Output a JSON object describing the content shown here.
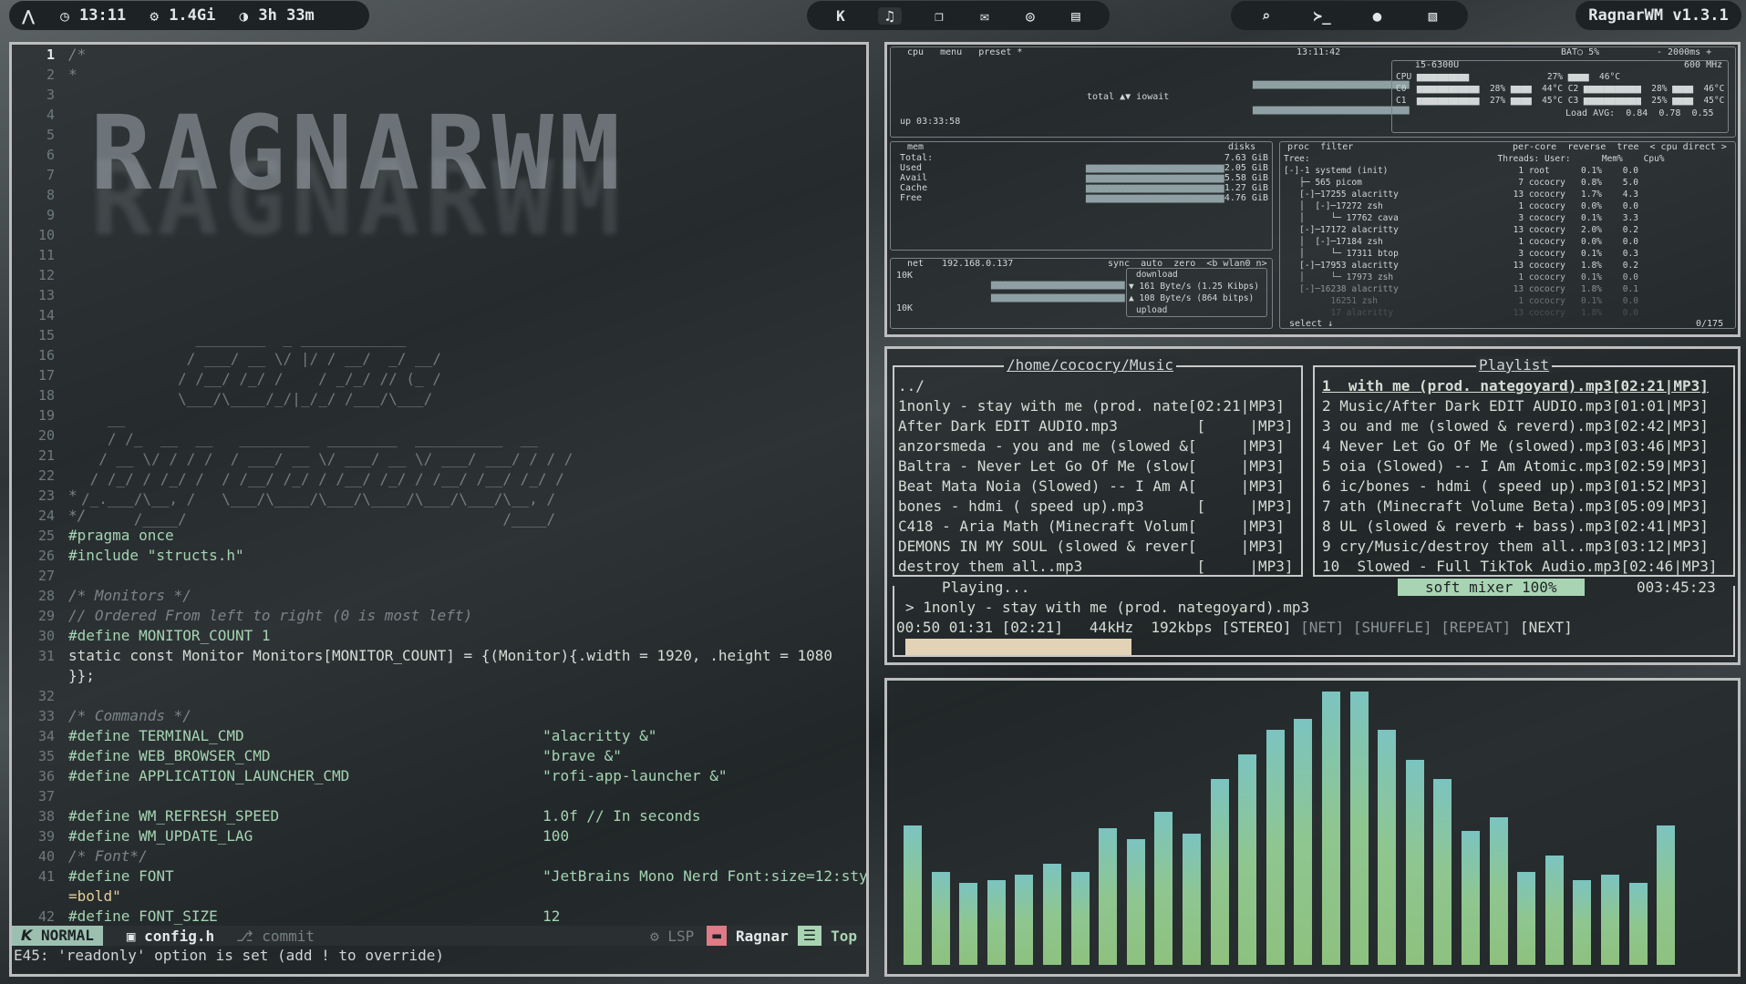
{
  "topbar": {
    "left": [
      {
        "icon": "arch-logo-icon",
        "label": ""
      },
      {
        "icon": "clock-icon",
        "label": "13:11"
      },
      {
        "icon": "memory-icon",
        "label": "1.4Gi"
      },
      {
        "icon": "uptime-icon",
        "label": "3h 33m"
      }
    ],
    "apps": [
      "k-app-icon",
      "music-icon",
      "copy-icon",
      "mail-icon",
      "gamepad-icon",
      "book-icon"
    ],
    "launchers": [
      "search-icon",
      "terminal-icon",
      "record-icon",
      "image-icon"
    ],
    "wm_name": "RagnarWM v1.3.1"
  },
  "editor": {
    "line_numbers": [
      "1",
      "2",
      "3",
      "4",
      "5",
      "6",
      "7",
      "8",
      "9",
      "10",
      "11",
      "12",
      "13",
      "14",
      "15",
      "16",
      "17",
      "18",
      "19",
      "20",
      "21",
      "22",
      "23",
      "24",
      "25",
      "26",
      "27",
      "28",
      "29",
      "30",
      "31",
      "",
      "32",
      "33",
      "34",
      "35",
      "36",
      "37",
      "38",
      "39",
      "40",
      "41",
      "",
      "42"
    ],
    "art_word": "RAGNARWM",
    "art_lines": [
      "",
      "",
      "",
      "",
      "",
      "",
      "",
      "",
      "",
      "",
      "",
      "",
      "             ________  _ ____________",
      "            / ___/ __ \\/ |/ / __/  _/ __/",
      "           / /__/ /_/ /    / _/_/ // (_ /",
      "           \\___/\\____/_/|_/_/ /___/\\___/",
      "   __",
      "   / /_  __  __   ________  ________  __________  __",
      "  / __ \\/ / / /  / ___/ __ \\/ ___/ __ \\/ ___/ ___/ / / /",
      " / /_/ / /_/ /  / /__/ /_/ / /__/ /_/ / /__/ /__/ /_/ /",
      "/_.___/\\__, /   \\___/\\____/\\___/\\____/\\___/\\___/\\__, /",
      "      /____/                                    /____/"
    ],
    "lines": [
      {
        "t": "/*",
        "c": "cm"
      },
      {
        "t": "*",
        "c": "cm"
      },
      {
        "t": "",
        "c": "tx"
      },
      {
        "t": "",
        "c": "tx"
      },
      {
        "t": "",
        "c": "tx"
      },
      {
        "t": "",
        "c": "tx"
      },
      {
        "t": "",
        "c": "tx"
      },
      {
        "t": "",
        "c": "tx"
      },
      {
        "t": "",
        "c": "tx"
      },
      {
        "t": "",
        "c": "tx"
      },
      {
        "t": "",
        "c": "tx"
      },
      {
        "t": "",
        "c": "tx"
      },
      {
        "t": "",
        "c": "tx"
      },
      {
        "t": "",
        "c": "tx"
      },
      {
        "t": "",
        "c": "tx"
      },
      {
        "t": "",
        "c": "tx"
      },
      {
        "t": "",
        "c": "tx"
      },
      {
        "t": "",
        "c": "tx"
      },
      {
        "t": "",
        "c": "tx"
      },
      {
        "t": "",
        "c": "tx"
      },
      {
        "t": "",
        "c": "tx"
      },
      {
        "t": "",
        "c": "tx"
      },
      {
        "t": "*",
        "c": "cm"
      },
      {
        "t": "*/",
        "c": "cm"
      },
      {
        "t": "#pragma once",
        "c": "pp"
      },
      {
        "t": "#include \"structs.h\"",
        "c": "pp"
      },
      {
        "t": "",
        "c": "tx"
      },
      {
        "t": "/* Monitors */",
        "c": "cm"
      },
      {
        "t": "// Ordered From left to right (0 is most left)",
        "c": "cm"
      },
      {
        "t": "#define MONITOR_COUNT 1",
        "c": "pp"
      },
      {
        "t": "static const Monitor Monitors[MONITOR_COUNT] = {(Monitor){.width = 1920, .height = 1080",
        "c": "tx"
      },
      {
        "t": "}};",
        "c": "tx"
      },
      {
        "t": "",
        "c": "tx"
      },
      {
        "t": "/* Commands */",
        "c": "cm"
      },
      {
        "t": "#define TERMINAL_CMD                                  \"alacritty &\"",
        "c": "pp"
      },
      {
        "t": "#define WEB_BROWSER_CMD                               \"brave &\"",
        "c": "pp"
      },
      {
        "t": "#define APPLICATION_LAUNCHER_CMD                      \"rofi-app-launcher &\"",
        "c": "pp"
      },
      {
        "t": "",
        "c": "tx"
      },
      {
        "t": "#define WM_REFRESH_SPEED                              1.0f // In seconds",
        "c": "pp"
      },
      {
        "t": "#define WM_UPDATE_LAG                                 100",
        "c": "pp"
      },
      {
        "t": "/* Font*/",
        "c": "cm"
      },
      {
        "t": "#define FONT                                          \"JetBrains Mono Nerd Font:size=12:style",
        "c": "pp"
      },
      {
        "t": "=bold\"",
        "c": "st"
      },
      {
        "t": "#define FONT_SIZE                                     12",
        "c": "pp"
      }
    ],
    "status": {
      "mode": "NORMAL",
      "file": "config.h",
      "commit": "commit",
      "lsp": "LSP",
      "user": "Ragnar",
      "position": "Top"
    },
    "message": "E45: 'readonly' option is set (add ! to override)"
  },
  "btop": {
    "cpu_header": {
      "tabs": [
        "cpu",
        "menu",
        "preset *"
      ],
      "time": "13:11:42",
      "battery": "BAT○ 5%",
      "interval": "- 2000ms +"
    },
    "cpu_model": "i5-6300U",
    "cpu_freq": "600 MHz",
    "cpu_rows": [
      "CPU ▆▆▆▆▆▆▆▆▆▆               27% ▆▆▆▆  46°C",
      "C0  ▆▆▆▆▆▆▆▆▆▆▆▆  28% ▆▆▆▆  44°C C2 ▆▆▆▆▆▆▆▆▆▆▆  28% ▆▆▆▆  46°C",
      "C1  ▆▆▆▆▆▆▆▆▆▆▆▆  27% ▆▆▆▆  45°C C3 ▆▆▆▆▆▆▆▆▆▆▆  25% ▆▆▆▆  45°C"
    ],
    "load_avg": "Load AVG:  0.84  0.78  0.55",
    "total_label": "total ▲▼ iowait",
    "uptime": "up 03:33:58",
    "mem": {
      "title": "mem",
      "disks": "disks",
      "rows": [
        {
          "k": "Total:",
          "v": "7.63 GiB"
        },
        {
          "k": "Used",
          "v": "2.05 GiB"
        },
        {
          "k": "Avail",
          "v": "5.58 GiB"
        },
        {
          "k": "Cache",
          "v": "1.27 GiB"
        },
        {
          "k": "Free",
          "v": "4.76 GiB"
        }
      ]
    },
    "net": {
      "title": "net",
      "ip": "192.168.0.137",
      "opts": "sync  auto  zero  <b wlan0 n>",
      "scale_top": "10K",
      "scale_bot": "10K",
      "download": "download",
      "down_val": "▼ 161 Byte/s (1.25 Kibps)",
      "up_val": "▲ 108 Byte/s (864 bitps)",
      "upload": "upload"
    },
    "proc": {
      "title": "proc  filter",
      "opts": "per-core  reverse  tree  < cpu direct >",
      "header": "Tree:                                    Threads: User:      Mem%    Cpu%",
      "rows": [
        "[-]-1 systemd (init)                         1 root      0.1%    0.0",
        "   ├─ 565 picom                              7 cococry   0.8%    5.0",
        "   [-]─17255 alacritty                      13 cococry   1.7%    4.3",
        "   │  [-]─17272 zsh                          1 cococry   0.0%    0.0",
        "   │     └─ 17762 cava                       3 cococry   0.1%    3.3",
        "   [-]─17172 alacritty                      13 cococry   2.0%    0.2",
        "   │  [-]─17184 zsh                          1 cococry   0.0%    0.0",
        "   │     └─ 17311 btop                       3 cococry   0.1%    0.3",
        "   [-]─17953 alacritty                      13 cococry   1.8%    0.2",
        "   │     └─ 17973 zsh                        1 cococry   0.1%    0.0",
        "   [-]─16238 alacritty                      13 cococry   1.8%    0.1",
        "         16251 zsh                           1 cococry   0.1%    0.0",
        "         17 alacritty                       13 cococry   1.8%    0.0"
      ],
      "select": "select ↓",
      "count": "0/175"
    }
  },
  "music": {
    "dir_title": "/home/cococry/Music",
    "playlist_title": "Playlist",
    "files": [
      "../",
      "1nonly - stay with me (prod. nate[02:21|MP3]",
      "After Dark EDIT AUDIO.mp3         [     |MP3]",
      "anzorsmeda - you and me (slowed &[     |MP3]",
      "Baltra - Never Let Go Of Me (slow[     |MP3]",
      "Beat Mata Noia (Slowed) -- I Am A[     |MP3]",
      "bones - hdmi ( speed up).mp3      [     |MP3]",
      "C418 - Aria Math (Minecraft Volum[     |MP3]",
      "DEMONS IN MY SOUL (slowed & rever[     |MP3]",
      "destroy them all..mp3             [     |MP3]"
    ],
    "playlist": [
      "1  with me (prod. nategoyard).mp3[02:21|MP3]",
      "2 Music/After Dark EDIT AUDIO.mp3[01:01|MP3]",
      "3 ou and me (slowed & reverd).mp3[02:42|MP3]",
      "4 Never Let Go Of Me (slowed).mp3[03:46|MP3]",
      "5 oia (Slowed) -- I Am Atomic.mp3[02:59|MP3]",
      "6 ic/bones - hdmi ( speed up).mp3[01:52|MP3]",
      "7 ath (Minecraft Volume Beta).mp3[05:09|MP3]",
      "8 UL (slowed & reverb + bass).mp3[02:41|MP3]",
      "9 cry/Music/destroy them all..mp3[03:12|MP3]",
      "10  Slowed - Full TikTok Audio.mp3[02:46|MP3]"
    ],
    "playing": "Playing...",
    "mixer": "soft mixer 100%",
    "total_time": "003:45:23",
    "now_playing": "> 1nonly - stay with me (prod. nategoyard).mp3",
    "times": "00:50 01:31 [02:21]   44kHz  192kbps [STEREO]",
    "flags": "[NET] [SHUFFLE] [REPEAT]",
    "next": "[NEXT]",
    "progress": 0.36
  },
  "visualizer": {
    "levels": [
      0.51,
      0.34,
      0.3,
      0.31,
      0.33,
      0.37,
      0.34,
      0.5,
      0.46,
      0.56,
      0.48,
      0.68,
      0.77,
      0.86,
      0.9,
      1.0,
      1.0,
      0.86,
      0.75,
      0.68,
      0.49,
      0.54,
      0.34,
      0.4,
      0.31,
      0.33,
      0.3,
      0.51
    ]
  },
  "colors": {
    "accent": "#9cc0b0",
    "bar_low": "#8dc17f",
    "bar_high": "#7bc4c0",
    "border": "#bdbdbd"
  }
}
